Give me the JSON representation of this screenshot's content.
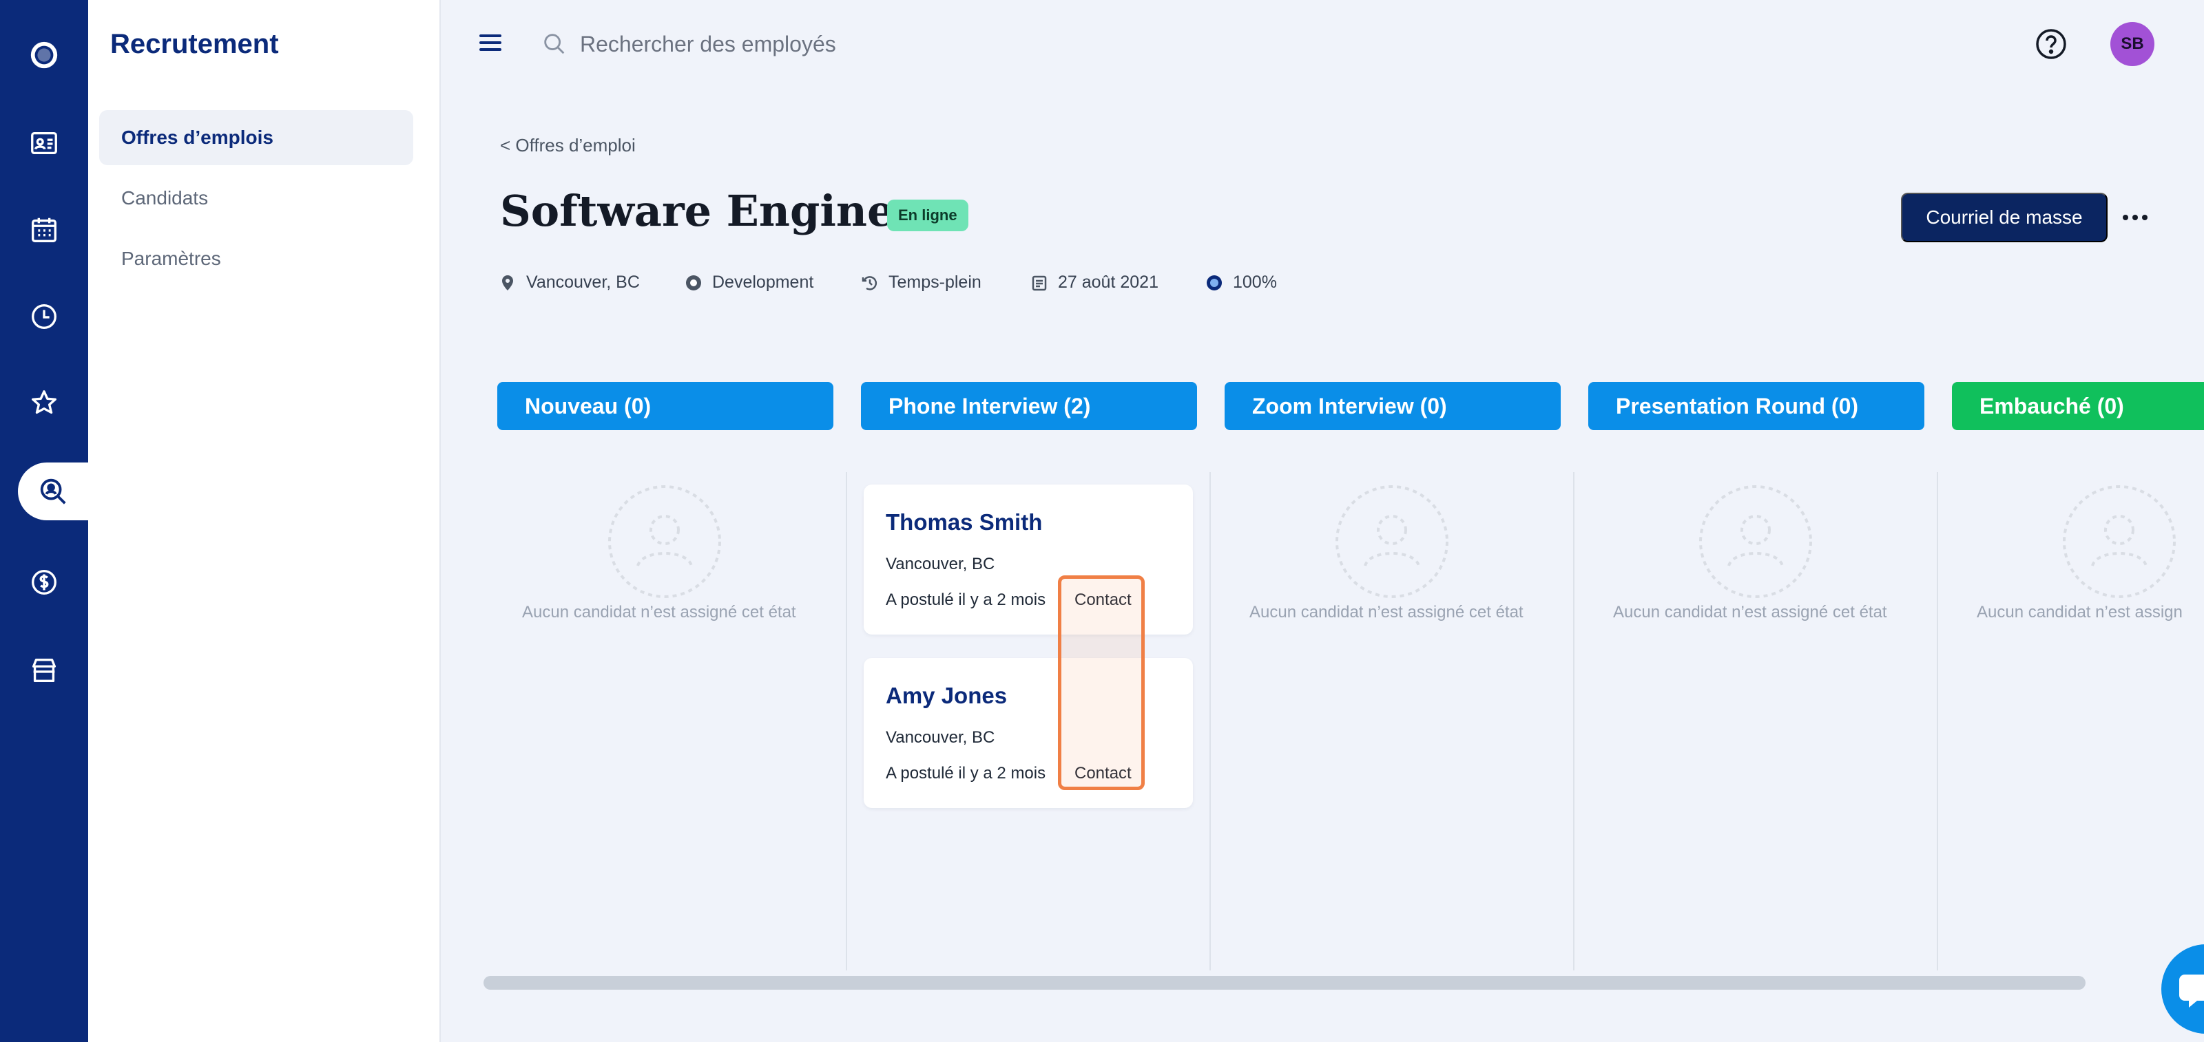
{
  "sidebar": {
    "title": "Recrutement",
    "items": [
      {
        "label": "Offres d’emplois"
      },
      {
        "label": "Candidats"
      },
      {
        "label": "Paramètres"
      }
    ]
  },
  "topbar": {
    "search_placeholder": "Rechercher des employés",
    "avatar_initials": "SB"
  },
  "job": {
    "breadcrumb": "< Offres d’emploi",
    "title": "Software Engineer",
    "status": "En ligne",
    "mass_mail_label": "Courriel de masse",
    "meta": {
      "location": "Vancouver, BC",
      "department": "Development",
      "type": "Temps-plein",
      "date": "27 août 2021",
      "percent": "100%"
    }
  },
  "columns": [
    {
      "title": "Nouveau (0)",
      "empty": "Aucun candidat n’est assigné cet état"
    },
    {
      "title": "Phone Interview (2)"
    },
    {
      "title": "Zoom Interview (0)",
      "empty": "Aucun candidat n’est assigné cet état"
    },
    {
      "title": "Presentation Round (0)",
      "empty": "Aucun candidat n’est assigné cet état"
    },
    {
      "title": "Embauché (0)",
      "empty": "Aucun candidat n’est assign"
    }
  ],
  "candidates": [
    {
      "name": "Thomas Smith",
      "location": "Vancouver, BC",
      "applied": "A postulé il y a 2 mois",
      "contact": "Contact"
    },
    {
      "name": "Amy Jones",
      "location": "Vancouver, BC",
      "applied": "A postulé il y a 2 mois",
      "contact": "Contact"
    }
  ],
  "colors": {
    "rail": "#0b2a7a",
    "column_header": "#0a8ee8",
    "hired_header": "#10c05c",
    "highlight": "#f07f45",
    "status_badge": "#6fe3b5"
  }
}
